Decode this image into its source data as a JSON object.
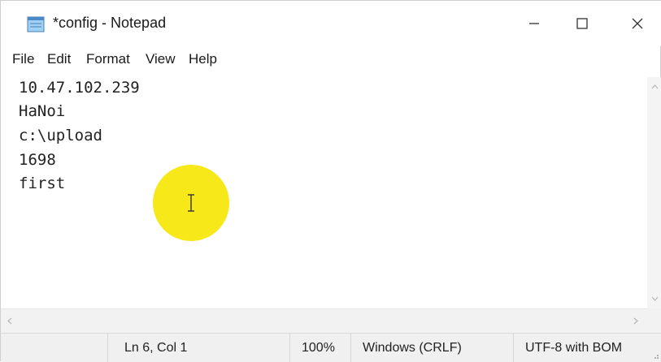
{
  "window": {
    "title": "*config - Notepad",
    "app_icon": "notepad-icon",
    "controls": {
      "minimize_icon": "minimize-icon",
      "maximize_icon": "maximize-icon",
      "close_icon": "close-icon"
    }
  },
  "menu": {
    "items": [
      "File",
      "Edit",
      "Format",
      "View",
      "Help"
    ]
  },
  "editor": {
    "lines": [
      "10.47.102.239",
      "HaNoi",
      "c:\\upload",
      "1698",
      "first"
    ]
  },
  "overlay": {
    "cursor_highlight_color": "#f7e81a",
    "cursor_icon": "i-beam-cursor-icon"
  },
  "status_bar": {
    "position": "Ln 6, Col 1",
    "zoom": "100%",
    "line_ending": "Windows (CRLF)",
    "encoding": "UTF-8 with BOM"
  }
}
